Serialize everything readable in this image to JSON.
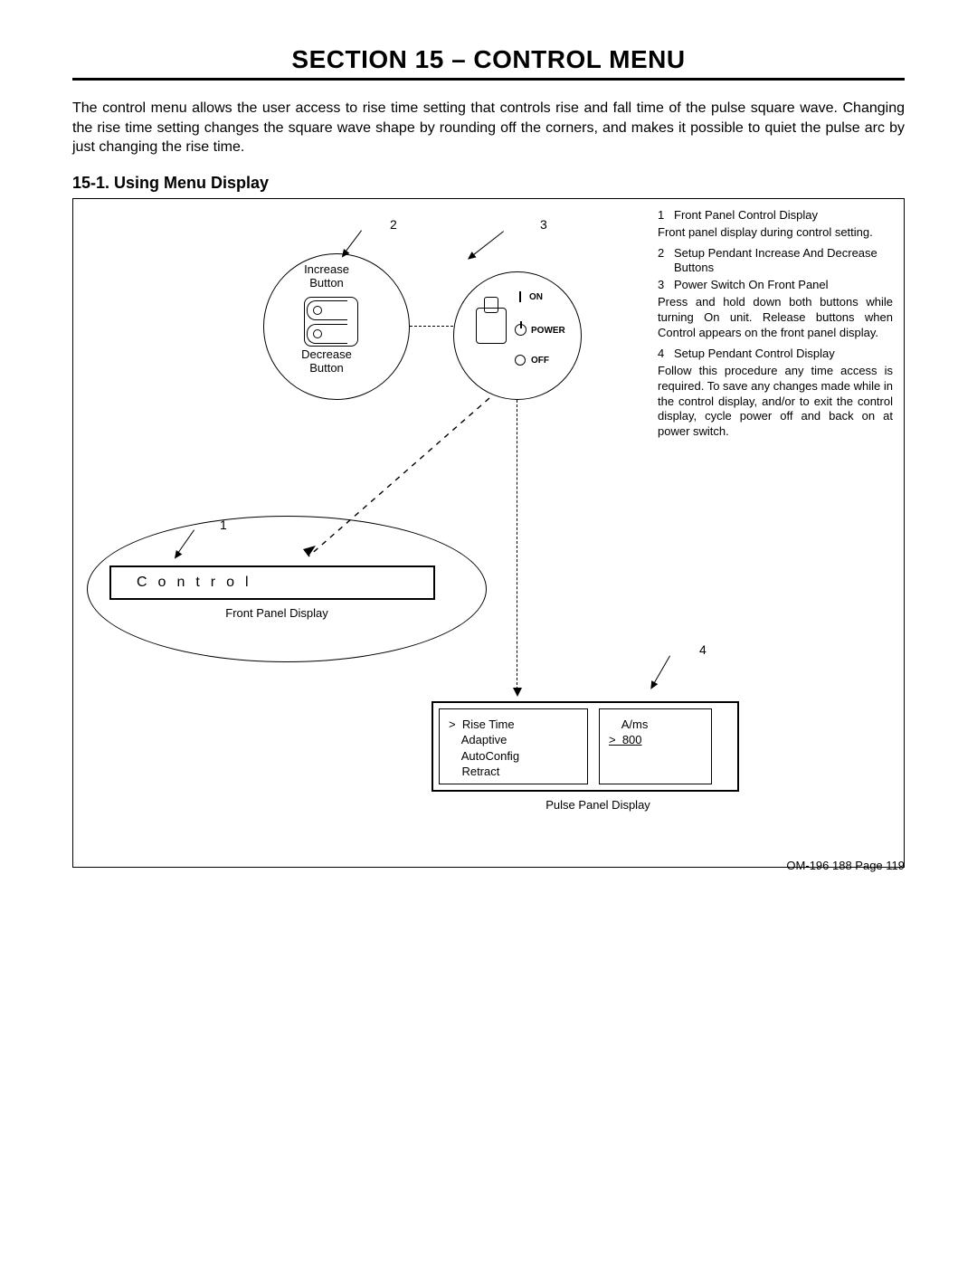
{
  "section_title": "SECTION 15 – CONTROL MENU",
  "intro": "The control menu allows the user access to rise time setting that controls rise and fall time of the pulse square wave. Changing the rise time setting changes the square wave shape by rounding off the corners, and makes it possible to quiet the pulse arc by just changing the rise time.",
  "sub_heading": "15-1.  Using Menu Display",
  "diagram": {
    "numbers": {
      "n1": "1",
      "n2": "2",
      "n3": "3",
      "n4": "4"
    },
    "increase_label_1": "Increase",
    "increase_label_2": "Button",
    "decrease_label_1": "Decrease",
    "decrease_label_2": "Button",
    "on_label": "ON",
    "power_label": "POWER",
    "off_label": "OFF",
    "control_text": "Control",
    "front_panel_caption": "Front Panel Display",
    "pulse_panel_caption": "Pulse Panel Display",
    "pulse_left": {
      "l1": ">  Rise Time",
      "l2": "    Adaptive",
      "l3": "    AutoConfig",
      "l4": "    Retract"
    },
    "pulse_right": {
      "r1": "    A/ms",
      "r2": ">  800"
    }
  },
  "callouts": {
    "c1_num": "1",
    "c1_txt": "Front Panel Control Display",
    "p1": "Front panel display during control setting.",
    "c2_num": "2",
    "c2_txt": "Setup Pendant Increase And Decrease Buttons",
    "c3_num": "3",
    "c3_txt": "Power Switch On Front Panel",
    "p2": "Press and hold down both buttons while turning On unit. Release buttons when Control appears on the front panel display.",
    "c4_num": "4",
    "c4_txt": "Setup Pendant Control Display",
    "p3": "Follow this procedure any time access is required. To save any changes made while in the control display, and/or to exit the control display, cycle power off and back on at power switch."
  },
  "footer": "OM-196 188 Page 119"
}
